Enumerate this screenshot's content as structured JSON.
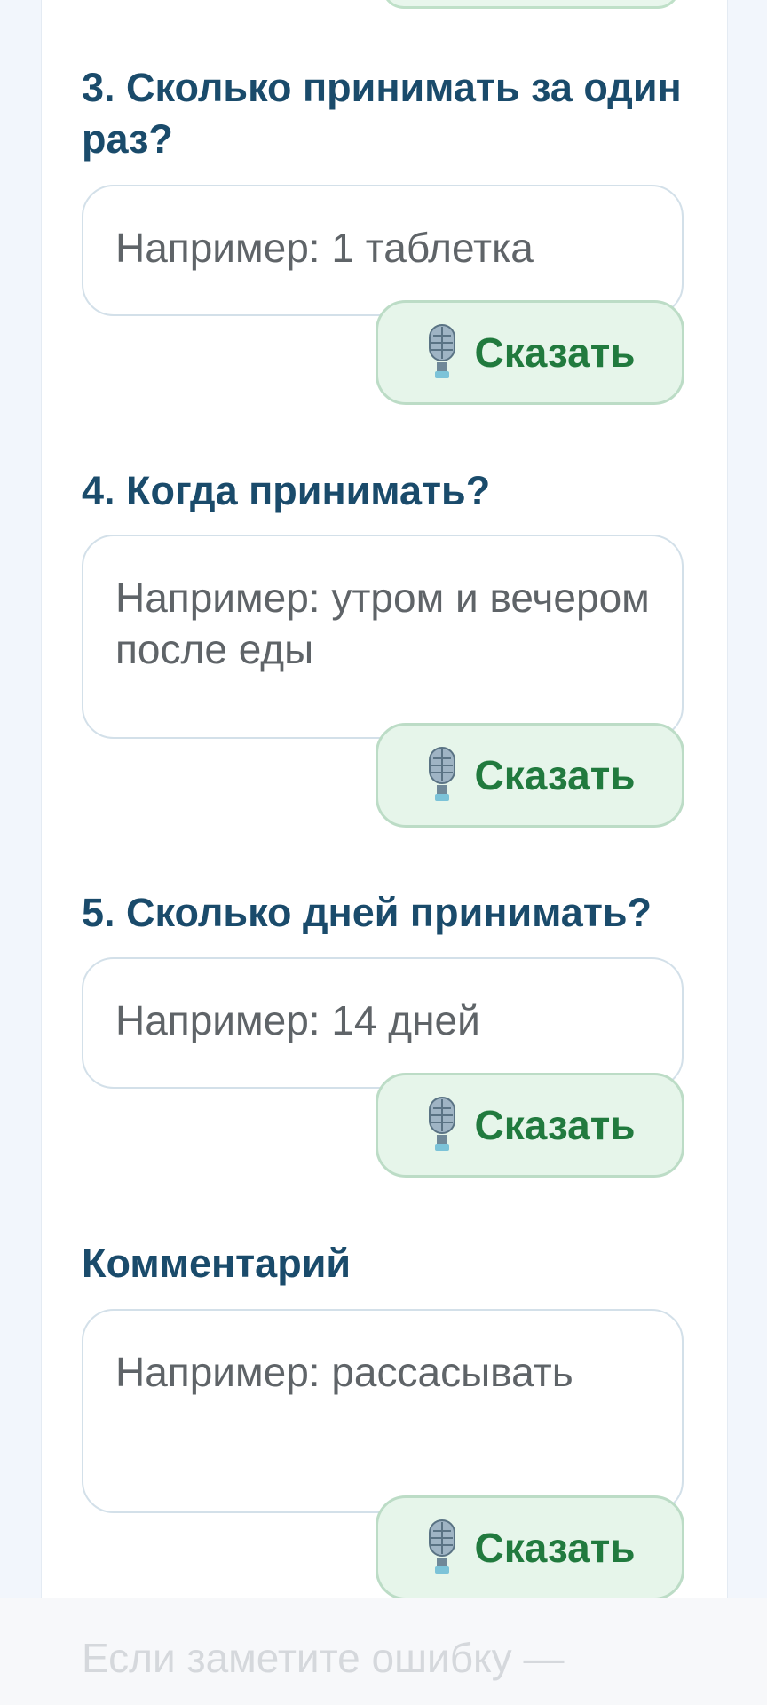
{
  "questions": [
    {
      "title": "3. Сколько принимать за один раз?",
      "placeholder": "Например: 1 таблетка",
      "button_label": "Сказать",
      "button_icon": "microphone-icon"
    },
    {
      "title": "4. Когда принимать?",
      "placeholder": "Например: утром и вечером после еды",
      "button_label": "Сказать",
      "button_icon": "microphone-icon"
    },
    {
      "title": "5. Сколько дней принимать?",
      "placeholder": "Например: 14 дней",
      "button_label": "Сказать",
      "button_icon": "microphone-icon"
    },
    {
      "title": "Комментарий",
      "placeholder": "Например: рассасывать",
      "button_label": "Сказать",
      "button_icon": "microphone-icon"
    }
  ],
  "footer": {
    "text": "Если заметите ошибку —"
  },
  "colors": {
    "heading": "#1a4b6b",
    "button_text": "#217a3e",
    "button_bg": "#e6f5ea",
    "button_border": "#bcdcc6",
    "field_border": "#d3e0e9",
    "page_bg": "#f2f6fc"
  }
}
